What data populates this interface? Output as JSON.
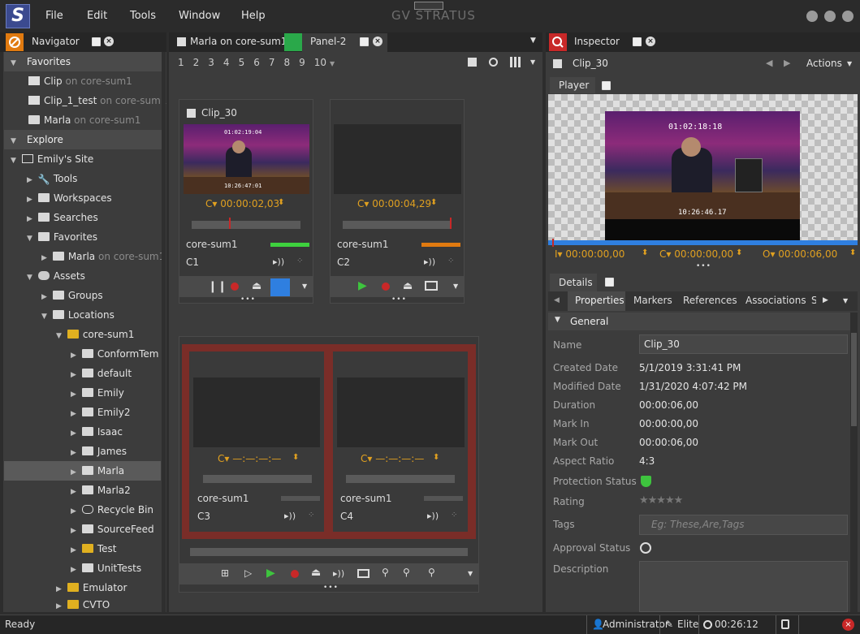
{
  "app": {
    "title": "GV STRATUS",
    "logo": "S",
    "menu": [
      "File",
      "Edit",
      "Tools",
      "Window",
      "Help"
    ]
  },
  "navigator": {
    "tab": "Navigator",
    "favorites_header": "Favorites",
    "favorites": [
      {
        "name": "Clip",
        "loc": "on core-sum1"
      },
      {
        "name": "Clip_1_test",
        "loc": "on core-sum1"
      },
      {
        "name": "Marla",
        "loc": "on core-sum1"
      }
    ],
    "explore_header": "Explore",
    "tree": [
      {
        "label": "Emily's Site",
        "loc": ""
      },
      {
        "label": "Tools",
        "loc": ""
      },
      {
        "label": "Workspaces",
        "loc": ""
      },
      {
        "label": "Searches",
        "loc": ""
      },
      {
        "label": "Favorites",
        "loc": ""
      },
      {
        "label": "Marla",
        "loc": "on core-sum1"
      },
      {
        "label": "Assets",
        "loc": ""
      },
      {
        "label": "Groups",
        "loc": ""
      },
      {
        "label": "Locations",
        "loc": ""
      },
      {
        "label": "core-sum1",
        "loc": ""
      },
      {
        "label": "ConformTem",
        "loc": ""
      },
      {
        "label": "default",
        "loc": ""
      },
      {
        "label": "Emily",
        "loc": ""
      },
      {
        "label": "Emily2",
        "loc": ""
      },
      {
        "label": "Isaac",
        "loc": ""
      },
      {
        "label": "James",
        "loc": ""
      },
      {
        "label": "Marla",
        "loc": ""
      },
      {
        "label": "Marla2",
        "loc": ""
      },
      {
        "label": "Recycle Bin",
        "loc": ""
      },
      {
        "label": "SourceFeed",
        "loc": ""
      },
      {
        "label": "Test",
        "loc": ""
      },
      {
        "label": "UnitTests",
        "loc": ""
      },
      {
        "label": "Emulator",
        "loc": ""
      },
      {
        "label": "CVTO",
        "loc": ""
      }
    ]
  },
  "center": {
    "tab1": "Marla on core-sum1",
    "tab2": "Panel-2",
    "pages": [
      "1",
      "2",
      "3",
      "4",
      "5",
      "6",
      "7",
      "8",
      "9",
      "10"
    ],
    "monitor1": {
      "clip": "Clip_30",
      "tc": "C▾ 00:00:02,03",
      "server": "core-sum1",
      "channel": "C1",
      "level_color": "#3ed13e",
      "video_tc": "01:02:19:04",
      "video_tc2": "10:26:47:01"
    },
    "monitor2": {
      "tc": "C▾ 00:00:04,29",
      "server": "core-sum1",
      "channel": "C2",
      "level_color": "#e07a10"
    },
    "monitor3": {
      "tc": "C▾ —:—:—:—",
      "server": "core-sum1",
      "channel": "C3"
    },
    "monitor4": {
      "tc": "C▾ —:—:—:—",
      "server": "core-sum1",
      "channel": "C4"
    }
  },
  "inspector": {
    "tab": "Inspector",
    "clip": "Clip_30",
    "actions": "Actions",
    "player_tab": "Player",
    "video_tc": "01:02:18:18",
    "video_tc2": "10:26:46.17",
    "in_tc": "I▾ 00:00:00,00",
    "cur_tc": "C▾ 00:00:00,00",
    "out_tc": "O▾ 00:00:06,00",
    "details_tab": "Details",
    "subtabs": [
      "Properties",
      "Markers",
      "References",
      "Associations",
      "S"
    ],
    "section": "General",
    "props": [
      {
        "label": "Name",
        "value": "Clip_30"
      },
      {
        "label": "Created Date",
        "value": "5/1/2019 3:31:41 PM"
      },
      {
        "label": "Modified Date",
        "value": "1/31/2020 4:07:42 PM"
      },
      {
        "label": "Duration",
        "value": "00:00:06,00"
      },
      {
        "label": "Mark In",
        "value": "00:00:00,00"
      },
      {
        "label": "Mark Out",
        "value": "00:00:06,00"
      },
      {
        "label": "Aspect Ratio",
        "value": "4:3"
      },
      {
        "label": "Protection Status",
        "value": ""
      },
      {
        "label": "Rating",
        "value": ""
      },
      {
        "label": "Tags",
        "value": ""
      },
      {
        "label": "Approval Status",
        "value": ""
      },
      {
        "label": "Description",
        "value": ""
      }
    ],
    "tags_placeholder": "Eg: These,Are,Tags",
    "rating": "★★★★★"
  },
  "status": {
    "left": "Ready",
    "user": "Administrator",
    "level": "Elite",
    "time": "00:26:12"
  },
  "colors": {
    "accent_orange": "#e07a10",
    "accent_red": "#c82828",
    "tab_green": "#2aa84a",
    "frame_red": "#7a2d28",
    "playhead_blue": "#2f7fe0"
  }
}
